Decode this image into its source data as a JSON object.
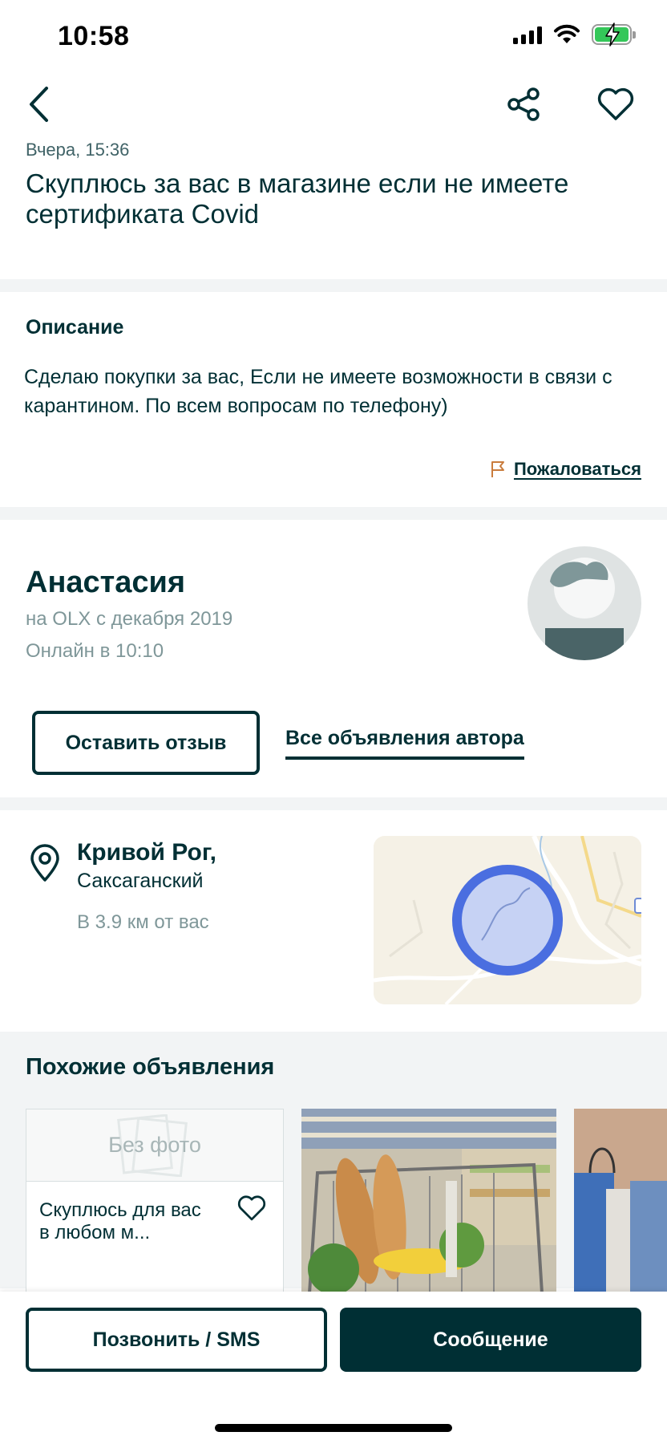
{
  "status_bar": {
    "time": "10:58"
  },
  "nav": {
    "back_icon": "chevron-left-icon",
    "share_icon": "share-icon",
    "favorite_icon": "heart-icon"
  },
  "ad": {
    "date": "Вчера, 15:36",
    "title": "Скуплюсь за вас в магазине если не имеете сертификата Covid"
  },
  "description": {
    "heading": "Описание",
    "text": "Сделаю покупки за вас, Если не имеете возможности в связи с карантином. По всем вопросам по телефону)",
    "report_label": "Пожаловаться"
  },
  "seller": {
    "name": "Анастасия",
    "since": "на OLX с декабря 2019",
    "online": "Онлайн в 10:10",
    "review_button": "Оставить отзыв",
    "all_ads_link": "Все объявления автора"
  },
  "location": {
    "city": "Кривой Рог,",
    "district": "Саксаганский",
    "distance": "В 3.9 км от вас"
  },
  "similar": {
    "heading": "Похожие объявления",
    "items": [
      {
        "no_photo_label": "Без фото",
        "title": "Скуплюсь для вас в любом м..."
      }
    ]
  },
  "bottom": {
    "call_button": "Позвонить / SMS",
    "message_button": "Сообщение"
  },
  "colors": {
    "primary": "#002f34",
    "muted": "#7f9799",
    "map_circle": "#4a6ee0",
    "separator": "#f2f4f5"
  }
}
